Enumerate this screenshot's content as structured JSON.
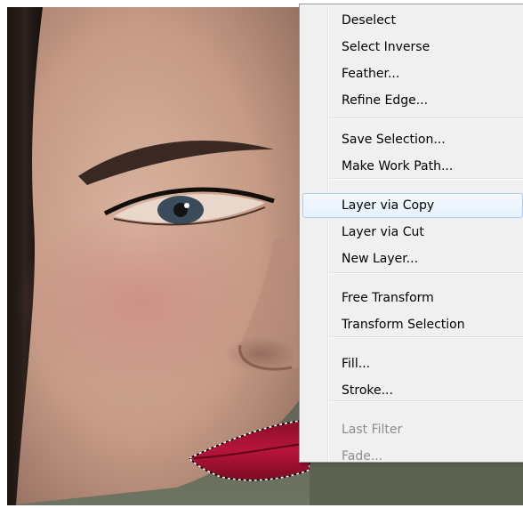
{
  "photo": {
    "subject": "close-up of face with lips selected by marching ants"
  },
  "context_menu": {
    "items": [
      {
        "label": "Deselect",
        "enabled": true
      },
      {
        "label": "Select Inverse",
        "enabled": true
      },
      {
        "label": "Feather...",
        "enabled": true
      },
      {
        "label": "Refine Edge...",
        "enabled": true
      },
      {
        "label": "Save Selection...",
        "enabled": true
      },
      {
        "label": "Make Work Path...",
        "enabled": true
      },
      {
        "label": "Layer via Copy",
        "enabled": true,
        "highlighted": true
      },
      {
        "label": "Layer via Cut",
        "enabled": true
      },
      {
        "label": "New Layer...",
        "enabled": true
      },
      {
        "label": "Free Transform",
        "enabled": true
      },
      {
        "label": "Transform Selection",
        "enabled": true
      },
      {
        "label": "Fill...",
        "enabled": true
      },
      {
        "label": "Stroke...",
        "enabled": true
      },
      {
        "label": "Last Filter",
        "enabled": false
      },
      {
        "label": "Fade...",
        "enabled": false
      }
    ],
    "colors": {
      "background": "#f0f0f0",
      "highlight_border": "#aeccef",
      "disabled_text": "#8d8d8d"
    }
  }
}
